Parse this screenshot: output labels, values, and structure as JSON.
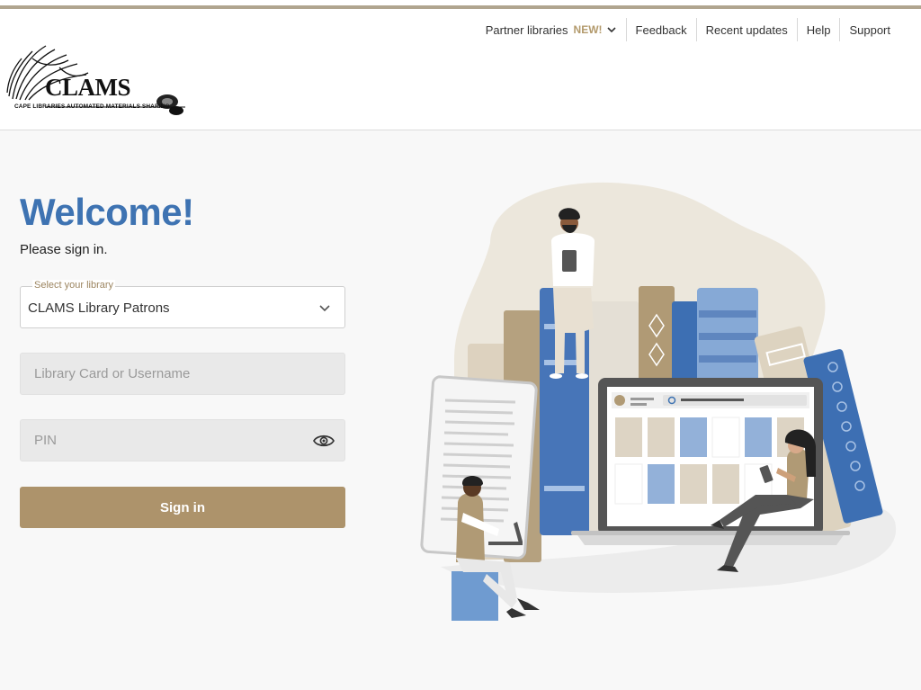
{
  "nav": {
    "partner_label": "Partner libraries",
    "partner_badge": "NEW!",
    "feedback": "Feedback",
    "recent_updates": "Recent updates",
    "help": "Help",
    "support": "Support"
  },
  "logo": {
    "name": "CLAMS",
    "tagline": "CAPE LIBRARIES AUTOMATED MATERIALS SHARING"
  },
  "login": {
    "heading": "Welcome!",
    "subheading": "Please sign in.",
    "library_label": "Select your library",
    "library_value": "CLAMS Library Patrons",
    "card_placeholder": "Library Card or Username",
    "pin_placeholder": "PIN",
    "submit": "Sign in"
  },
  "colors": {
    "accent": "#ad936b",
    "heading": "#3e73b2",
    "top_rule": "#b0a58f"
  },
  "icons": [
    "chevron-down-icon",
    "eye-icon",
    "search-icon"
  ]
}
